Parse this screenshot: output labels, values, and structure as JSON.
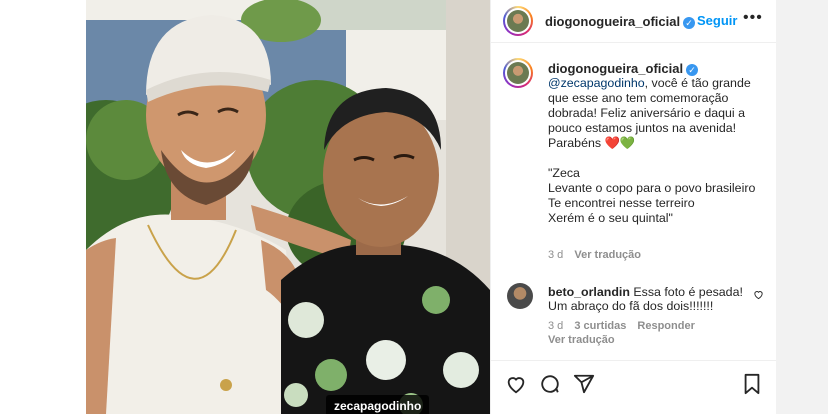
{
  "post": {
    "username": "diogonogueira_oficial",
    "follow_label": "Seguir",
    "more_label": "•••",
    "verified_mark": "✓",
    "photo_tag": "zecapagodinho"
  },
  "caption": {
    "mention": "@zecapagodinho",
    "text": ", você é tão grande que esse ano tem comemoração dobrada! Feliz aniversário e daqui a pouco estamos juntos na avenida! Parabéns ❤️💚\n\n\"Zeca\nLevante o copo para o povo brasileiro\nTe encontrei nesse terreiro\nXerém é o seu quintal\"",
    "age": "3 d",
    "translate": "Ver tradução"
  },
  "comment": {
    "username": "beto_orlandin",
    "text": "Essa foto é pesada! Um abraço do fã dos dois!!!!!!!",
    "age": "3 d",
    "likes": "3 curtidas",
    "reply": "Responder",
    "translate": "Ver tradução"
  },
  "actions": {
    "like_icon": "heart-icon",
    "comment_icon": "comment-icon",
    "share_icon": "share-icon",
    "save_icon": "bookmark-icon"
  },
  "colors": {
    "link": "#0095f6",
    "mention": "#00376b",
    "muted": "#8e8e8e",
    "verified": "#3897f0"
  }
}
